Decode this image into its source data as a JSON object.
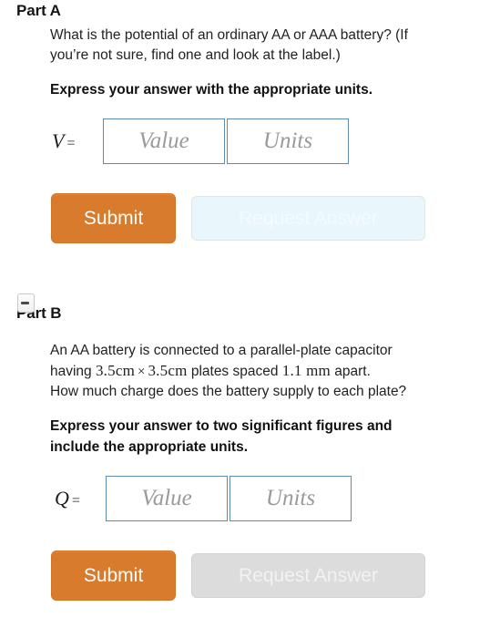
{
  "parts": [
    {
      "id": "part-a",
      "heading": "Part A",
      "has_collapse_toggle": false,
      "collapse_icon": "minus-icon",
      "question_lines": [
        "What is the potential of an ordinary AA or AAA battery? (If",
        "you’re not sure, find one and look at the label.)"
      ],
      "instruction_lines": [
        "Express your answer with the appropriate units."
      ],
      "answer": {
        "symbol": "V",
        "equals": "=",
        "value_placeholder": "Value",
        "units_placeholder": "Units"
      },
      "buttons": {
        "submit_label": "Submit",
        "request_label": "Request Answer",
        "request_state": "variant-blue"
      }
    },
    {
      "id": "part-b",
      "heading": "Part B",
      "has_collapse_toggle": true,
      "collapse_icon": "minus-icon",
      "question_parts": [
        {
          "type": "text",
          "text": "An AA battery is connected to a parallel-plate capacitor"
        },
        {
          "type": "break"
        },
        {
          "type": "text",
          "text": "having "
        },
        {
          "type": "math",
          "text": "3.5cm"
        },
        {
          "type": "times",
          "text": "×"
        },
        {
          "type": "math",
          "text": "3.5cm"
        },
        {
          "type": "text",
          "text": " plates spaced "
        },
        {
          "type": "math",
          "text": "1.1 mm"
        },
        {
          "type": "text",
          "text": " apart."
        },
        {
          "type": "break"
        },
        {
          "type": "text",
          "text": "How much charge does the battery supply to each plate?"
        }
      ],
      "instruction_lines": [
        "Express your answer to two significant figures and",
        "include the appropriate units."
      ],
      "answer": {
        "symbol": "Q",
        "equals": "=",
        "value_placeholder": "Value",
        "units_placeholder": "Units"
      },
      "buttons": {
        "submit_label": "Submit",
        "request_label": "Request Answer",
        "request_state": "variant-gray"
      }
    }
  ],
  "colors": {
    "submit_orange": "#d97b2c",
    "input_border_blue": "#5d8cae",
    "request_disabled_blue": "#e9f6fb",
    "request_disabled_gray": "#dcdcdc",
    "placeholder_gray": "#9a9a9a",
    "body_text": "#222222"
  }
}
